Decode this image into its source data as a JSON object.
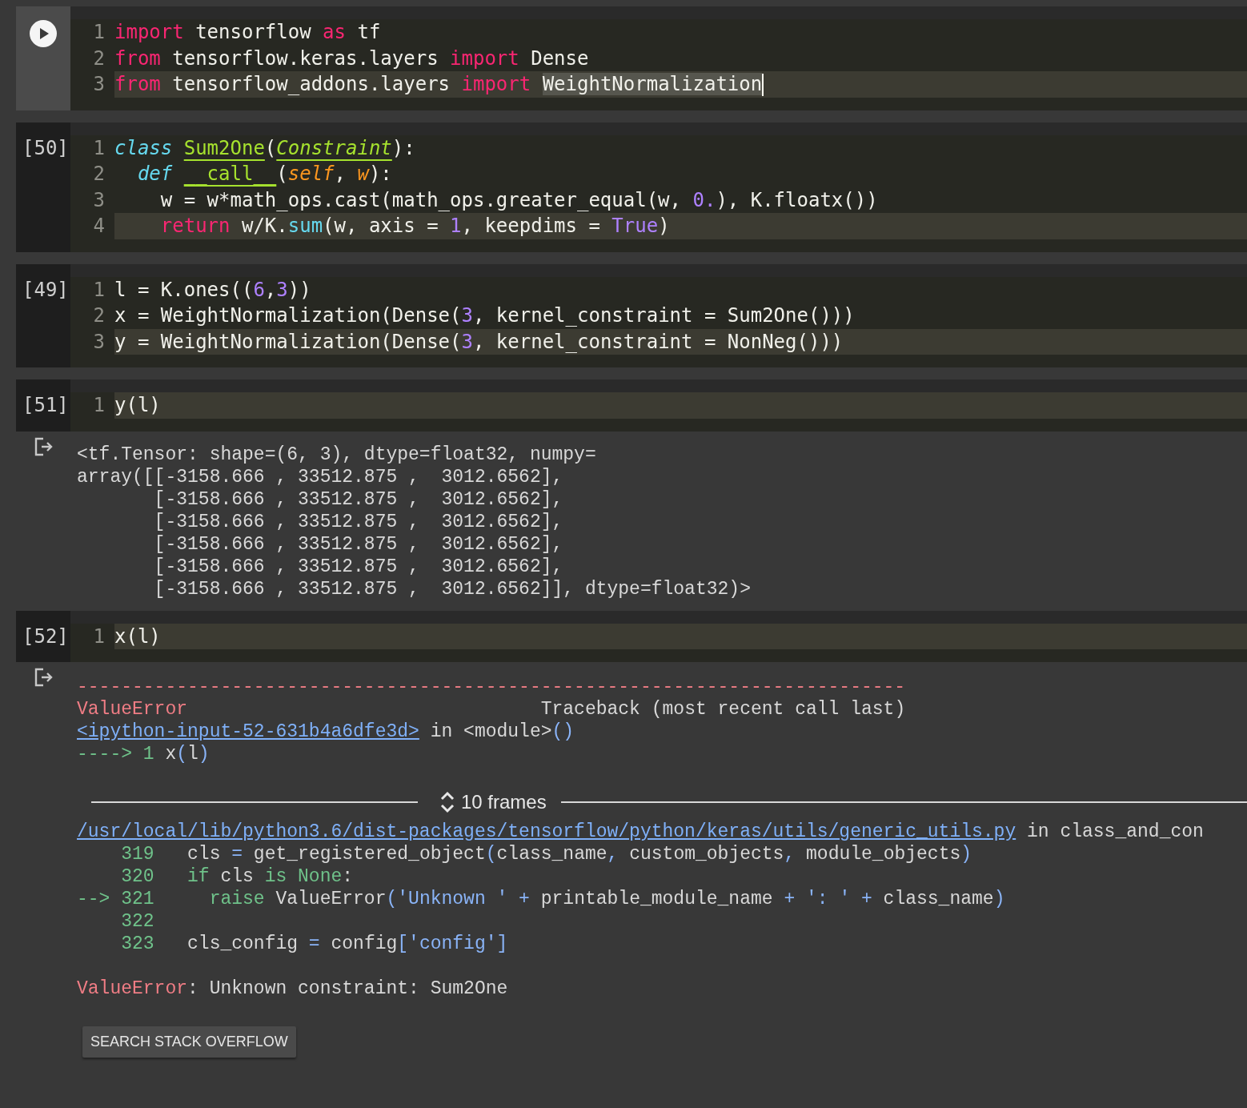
{
  "cells": [
    {
      "focused": true,
      "lines": [
        {
          "number": "1",
          "highlighted": false,
          "cursor": false,
          "tokens": [
            {
              "text": "import",
              "kind": "keyword"
            },
            {
              "text": " tensorflow ",
              "kind": "plain"
            },
            {
              "text": "as",
              "kind": "keyword"
            },
            {
              "text": " tf",
              "kind": "plain"
            }
          ]
        },
        {
          "number": "2",
          "highlighted": false,
          "cursor": false,
          "tokens": [
            {
              "text": "from",
              "kind": "keyword"
            },
            {
              "text": " tensorflow.keras.layers ",
              "kind": "plain"
            },
            {
              "text": "import",
              "kind": "keyword"
            },
            {
              "text": " Dense",
              "kind": "plain"
            }
          ]
        },
        {
          "number": "3",
          "highlighted": true,
          "cursor": true,
          "tokens": [
            {
              "text": "from",
              "kind": "keyword"
            },
            {
              "text": " tensorflow_addons.layers ",
              "kind": "plain"
            },
            {
              "text": "import ",
              "kind": "keyword"
            },
            {
              "text": "WeightNormalization",
              "kind": "selected"
            }
          ]
        }
      ]
    },
    {
      "focused": false,
      "execution_count": "[50]",
      "lines": [
        {
          "number": "1",
          "highlighted": false,
          "cursor": false,
          "tokens": [
            {
              "text": "class ",
              "kind": "storage"
            },
            {
              "text": "Sum2One",
              "kind": "classname"
            },
            {
              "text": "(",
              "kind": "plain"
            },
            {
              "text": "Constraint",
              "kind": "baseclass"
            },
            {
              "text": "):",
              "kind": "plain"
            }
          ]
        },
        {
          "number": "2",
          "highlighted": false,
          "cursor": false,
          "tokens": [
            {
              "text": "  def ",
              "kind": "storage"
            },
            {
              "text": "__call__",
              "kind": "classname"
            },
            {
              "text": "(",
              "kind": "plain"
            },
            {
              "text": "self",
              "kind": "param"
            },
            {
              "text": ", ",
              "kind": "plain"
            },
            {
              "text": "w",
              "kind": "param"
            },
            {
              "text": "):",
              "kind": "plain"
            }
          ]
        },
        {
          "number": "3",
          "highlighted": false,
          "cursor": false,
          "tokens": [
            {
              "text": "    w = w*math_ops.cast(math_ops.greater_equal(w, ",
              "kind": "plain"
            },
            {
              "text": "0.",
              "kind": "number"
            },
            {
              "text": "), K.floatx())",
              "kind": "plain"
            }
          ]
        },
        {
          "number": "4",
          "highlighted": true,
          "cursor": false,
          "tokens": [
            {
              "text": "    return",
              "kind": "keyword"
            },
            {
              "text": " w/K.",
              "kind": "plain"
            },
            {
              "text": "sum",
              "kind": "builtin"
            },
            {
              "text": "(w, axis = ",
              "kind": "plain"
            },
            {
              "text": "1",
              "kind": "number"
            },
            {
              "text": ", keepdims = ",
              "kind": "plain"
            },
            {
              "text": "True",
              "kind": "number"
            },
            {
              "text": ")",
              "kind": "plain"
            }
          ]
        }
      ]
    },
    {
      "focused": false,
      "execution_count": "[49]",
      "lines": [
        {
          "number": "1",
          "highlighted": false,
          "cursor": false,
          "tokens": [
            {
              "text": "l = K.ones((",
              "kind": "plain"
            },
            {
              "text": "6",
              "kind": "number"
            },
            {
              "text": ",",
              "kind": "plain"
            },
            {
              "text": "3",
              "kind": "number"
            },
            {
              "text": "))",
              "kind": "plain"
            }
          ]
        },
        {
          "number": "2",
          "highlighted": false,
          "cursor": false,
          "tokens": [
            {
              "text": "x = WeightNormalization(Dense(",
              "kind": "plain"
            },
            {
              "text": "3",
              "kind": "number"
            },
            {
              "text": ", kernel_constraint = Sum2One()))",
              "kind": "plain"
            }
          ]
        },
        {
          "number": "3",
          "highlighted": true,
          "cursor": false,
          "tokens": [
            {
              "text": "y = WeightNormalization(Dense(",
              "kind": "plain"
            },
            {
              "text": "3",
              "kind": "number"
            },
            {
              "text": ", kernel_constraint = NonNeg()))",
              "kind": "plain"
            }
          ]
        }
      ]
    },
    {
      "focused": false,
      "execution_count": "[51]",
      "lines": [
        {
          "number": "1",
          "highlighted": true,
          "cursor": false,
          "tokens": [
            {
              "text": "y(l)",
              "kind": "plain"
            }
          ]
        }
      ],
      "output": {
        "kind": "stream",
        "lines": [
          "<tf.Tensor: shape=(6, 3), dtype=float32, numpy=",
          "array([[-3158.666 , 33512.875 ,  3012.6562],",
          "       [-3158.666 , 33512.875 ,  3012.6562],",
          "       [-3158.666 , 33512.875 ,  3012.6562],",
          "       [-3158.666 , 33512.875 ,  3012.6562],",
          "       [-3158.666 , 33512.875 ,  3012.6562],",
          "       [-3158.666 , 33512.875 ,  3012.6562]], dtype=float32)>"
        ]
      }
    },
    {
      "focused": false,
      "execution_count": "[52]",
      "lines": [
        {
          "number": "1",
          "highlighted": true,
          "cursor": false,
          "tokens": [
            {
              "text": "x(l)",
              "kind": "plain"
            }
          ]
        }
      ],
      "output": {
        "kind": "error",
        "header_lines": [
          [
            {
              "text": "---------------------------------------------------------------------------",
              "kind": "red"
            }
          ],
          [
            {
              "text": "ValueError",
              "kind": "red"
            },
            {
              "text": "                                Traceback (most recent call last)",
              "kind": "plain"
            }
          ],
          [
            {
              "text": "<ipython-input-52-631b4a6dfe3d>",
              "kind": "link"
            },
            {
              "text": " in <module>",
              "kind": "plain"
            },
            {
              "text": "()",
              "kind": "op"
            }
          ],
          [
            {
              "text": "----> 1 ",
              "kind": "green"
            },
            {
              "text": "x",
              "kind": "plain"
            },
            {
              "text": "(",
              "kind": "op"
            },
            {
              "text": "l",
              "kind": "plain"
            },
            {
              "text": ")",
              "kind": "op"
            }
          ]
        ],
        "frames_label": "10 frames",
        "frame_lines": [
          [
            {
              "text": "/usr/local/lib/python3.6/dist-packages/tensorflow/python/keras/utils/generic_utils.py",
              "kind": "link"
            },
            {
              "text": " in class_and_con",
              "kind": "plain"
            }
          ],
          [
            {
              "text": "    319",
              "kind": "green"
            },
            {
              "text": "   cls ",
              "kind": "plain"
            },
            {
              "text": "=",
              "kind": "op"
            },
            {
              "text": " get_registered_object",
              "kind": "plain"
            },
            {
              "text": "(",
              "kind": "op"
            },
            {
              "text": "class_name",
              "kind": "plain"
            },
            {
              "text": ",",
              "kind": "op"
            },
            {
              "text": " custom_objects",
              "kind": "plain"
            },
            {
              "text": ",",
              "kind": "op"
            },
            {
              "text": " module_objects",
              "kind": "plain"
            },
            {
              "text": ")",
              "kind": "op"
            }
          ],
          [
            {
              "text": "    320   if",
              "kind": "green"
            },
            {
              "text": " cls ",
              "kind": "plain"
            },
            {
              "text": "is None",
              "kind": "green"
            },
            {
              "text": ":",
              "kind": "plain"
            }
          ],
          [
            {
              "text": "--> 321     raise",
              "kind": "green"
            },
            {
              "text": " ValueError",
              "kind": "plain"
            },
            {
              "text": "(",
              "kind": "op"
            },
            {
              "text": "'Unknown '",
              "kind": "string"
            },
            {
              "text": " +",
              "kind": "op"
            },
            {
              "text": " printable_module_name ",
              "kind": "plain"
            },
            {
              "text": "+ ': ' +",
              "kind": "string"
            },
            {
              "text": " class_name",
              "kind": "plain"
            },
            {
              "text": ")",
              "kind": "op"
            }
          ],
          [
            {
              "text": "    322",
              "kind": "green"
            }
          ],
          [
            {
              "text": "    323",
              "kind": "green"
            },
            {
              "text": "   cls_config ",
              "kind": "plain"
            },
            {
              "text": "=",
              "kind": "op"
            },
            {
              "text": " config",
              "kind": "plain"
            },
            {
              "text": "[",
              "kind": "op"
            },
            {
              "text": "'config'",
              "kind": "string"
            },
            {
              "text": "]",
              "kind": "op"
            }
          ]
        ],
        "message": [
          {
            "text": "ValueError",
            "kind": "red"
          },
          {
            "text": ": Unknown constraint: Sum2One",
            "kind": "plain"
          }
        ],
        "button": "SEARCH STACK OVERFLOW"
      }
    }
  ]
}
